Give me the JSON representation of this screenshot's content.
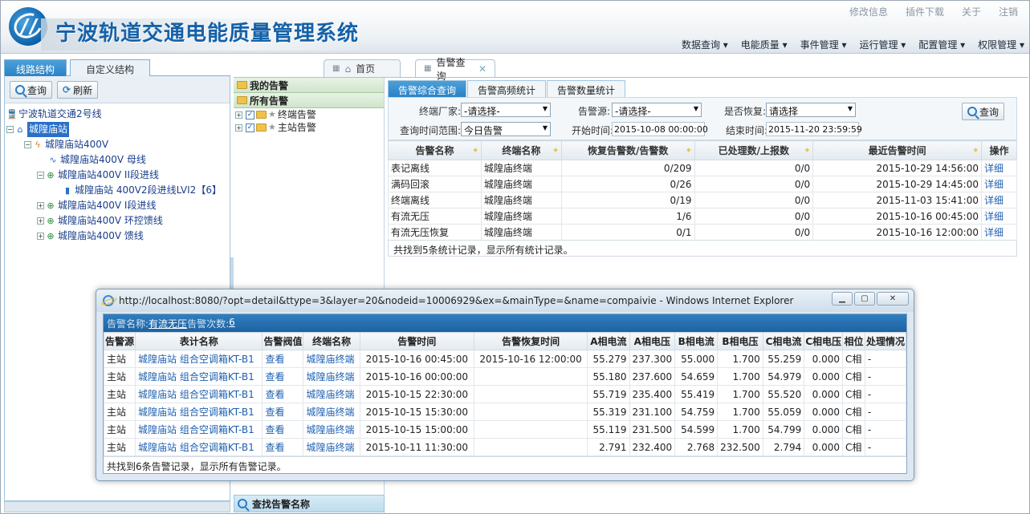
{
  "header": {
    "title": "宁波轨道交通电能质量管理系统",
    "top_links": [
      "修改信息",
      "插件下载",
      "关于",
      "注销"
    ],
    "nav": [
      "数据查询 ▾",
      "电能质量 ▾",
      "事件管理 ▾",
      "运行管理 ▾",
      "配置管理 ▾",
      "权限管理 ▾"
    ]
  },
  "left": {
    "tabs": [
      "线路结构",
      "自定义结构"
    ],
    "query_btn": "查询",
    "refresh_btn": "刷新",
    "tree": {
      "line": "宁波轨道交通2号线",
      "station": "城隍庙站",
      "sub": "城隍庙站400V",
      "bus": "城隍庙站400V 母线",
      "feeder2": "城隍庙站400V II段进线",
      "device": "城隍庙站 400V2段进线LVI2【6】",
      "feeder1": "城隍庙站400V I段进线",
      "loop": "城隍庙站400V 环控馈线",
      "feedout": "城隍庙站400V 馈线"
    }
  },
  "page_tabs": {
    "home": "首页",
    "alarm": "告警查询"
  },
  "alarm_tree": {
    "my": "我的告警",
    "all": "所有告警",
    "terminal": "终端告警",
    "master": "主站告警",
    "find": "查找告警名称"
  },
  "sub_tabs": [
    "告警综合查询",
    "告警高频统计",
    "告警数量统计"
  ],
  "filters": {
    "vendor_label": "终端厂家:",
    "vendor_val": "-请选择-",
    "source_label": "告警源:",
    "source_val": "-请选择-",
    "recover_label": "是否恢复:",
    "recover_val": "请选择",
    "range_label": "查询时间范围:",
    "range_val": "今日告警",
    "start_label": "开始时间:",
    "start_val": "2015-10-08 00:00:00",
    "end_label": "结束时间:",
    "end_val": "2015-11-20 23:59:59",
    "query_btn": "查询"
  },
  "summary": {
    "headers": [
      "告警名称",
      "终端名称",
      "恢复告警数/告警数",
      "已处理数/上报数",
      "最近告警时间",
      "操作"
    ],
    "rows": [
      [
        "表记离线",
        "城隍庙终端",
        "0/209",
        "0/0",
        "2015-10-29 14:56:00",
        "详细"
      ],
      [
        "满码回滚",
        "城隍庙终端",
        "0/26",
        "0/0",
        "2015-10-29 14:45:00",
        "详细"
      ],
      [
        "终端离线",
        "城隍庙终端",
        "0/19",
        "0/0",
        "2015-11-03 15:41:00",
        "详细"
      ],
      [
        "有流无压",
        "城隍庙终端",
        "1/6",
        "0/0",
        "2015-10-16 00:45:00",
        "详细"
      ],
      [
        "有流无压恢复",
        "城隍庙终端",
        "0/1",
        "0/0",
        "2015-10-16 12:00:00",
        "详细"
      ]
    ],
    "footer": "共找到5条统计记录，显示所有统计记录。"
  },
  "popup": {
    "title": "http://localhost:8080/?opt=detail&ttype=3&layer=20&nodeid=10006929&ex=&mainType=&name=compaivie - Windows Internet Explorer",
    "name_label": "告警名称: ",
    "name_val": "有流无压",
    "count_label": " 告警次数: ",
    "count_val": "6",
    "headers": [
      "告警源",
      "表计名称",
      "告警阀值",
      "终端名称",
      "告警时间",
      "告警恢复时间",
      "A相电流",
      "A相电压",
      "B相电流",
      "B相电压",
      "C相电流",
      "C相电压",
      "相位",
      "处理情况"
    ],
    "rows": [
      [
        "主站",
        "城隍庙站 组合空调箱KT-B1",
        "查看",
        "城隍庙终端",
        "2015-10-16 00:45:00",
        "2015-10-16 12:00:00",
        "55.279",
        "237.300",
        "55.000",
        "1.700",
        "55.259",
        "0.000",
        "C相",
        "-"
      ],
      [
        "主站",
        "城隍庙站 组合空调箱KT-B1",
        "查看",
        "城隍庙终端",
        "2015-10-16 00:00:00",
        "",
        "55.180",
        "237.600",
        "54.659",
        "1.700",
        "54.979",
        "0.000",
        "C相",
        "-"
      ],
      [
        "主站",
        "城隍庙站 组合空调箱KT-B1",
        "查看",
        "城隍庙终端",
        "2015-10-15 22:30:00",
        "",
        "55.719",
        "235.400",
        "55.419",
        "1.700",
        "55.520",
        "0.000",
        "C相",
        "-"
      ],
      [
        "主站",
        "城隍庙站 组合空调箱KT-B1",
        "查看",
        "城隍庙终端",
        "2015-10-15 15:30:00",
        "",
        "55.319",
        "231.100",
        "54.759",
        "1.700",
        "55.059",
        "0.000",
        "C相",
        "-"
      ],
      [
        "主站",
        "城隍庙站 组合空调箱KT-B1",
        "查看",
        "城隍庙终端",
        "2015-10-15 15:00:00",
        "",
        "55.119",
        "231.500",
        "54.599",
        "1.700",
        "54.799",
        "0.000",
        "C相",
        "-"
      ],
      [
        "主站",
        "城隍庙站 组合空调箱KT-B1",
        "查看",
        "城隍庙终端",
        "2015-10-11 11:30:00",
        "",
        "2.791",
        "232.400",
        "2.768",
        "232.500",
        "2.794",
        "0.000",
        "C相",
        "-"
      ]
    ],
    "footer": "共找到6条告警记录，显示所有告警记录。"
  }
}
